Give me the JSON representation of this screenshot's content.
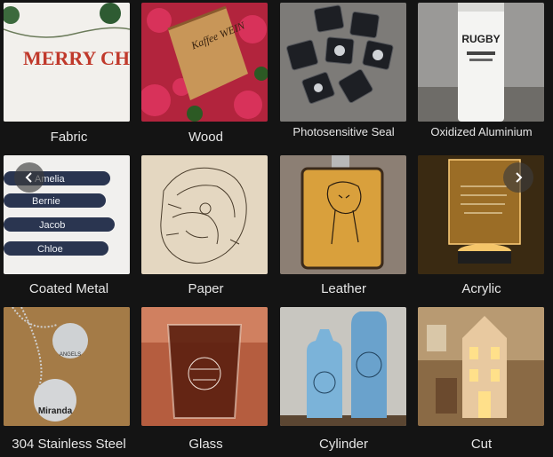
{
  "materials": [
    {
      "label": "Fabric",
      "thumb_text": "MERRY CHRISTMAS"
    },
    {
      "label": "Wood",
      "thumb_text": "Kaffee WEIN"
    },
    {
      "label": "Photosensitive Seal"
    },
    {
      "label": "Oxidized Aluminium",
      "thumb_text": "RUGBY"
    },
    {
      "label": "Coated Metal",
      "names": [
        "Amelia",
        "Bernie",
        "Jacob",
        "Chloe"
      ]
    },
    {
      "label": "Paper"
    },
    {
      "label": "Leather"
    },
    {
      "label": "Acrylic"
    },
    {
      "label": "304 Stainless Steel",
      "names": [
        "ANGELS",
        "Miranda"
      ]
    },
    {
      "label": "Glass"
    },
    {
      "label": "Cylinder"
    },
    {
      "label": "Cut"
    }
  ],
  "carousel": {
    "prev_icon": "chevron-left-icon",
    "next_icon": "chevron-right-icon"
  },
  "colors": {
    "background": "#141414",
    "caption": "#e6e6e6"
  }
}
